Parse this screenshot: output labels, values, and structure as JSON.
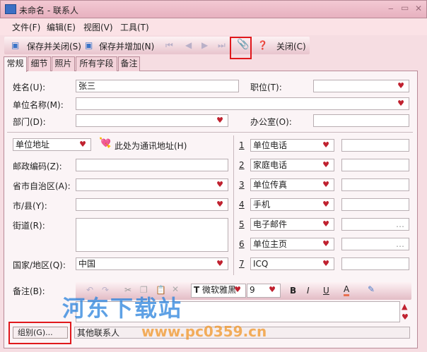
{
  "window": {
    "title": "未命名 - 联系人",
    "min": "‒",
    "max": "▭",
    "close": "✕"
  },
  "menu": [
    "文件(F)",
    "编辑(E)",
    "视图(V)",
    "工具(T)"
  ],
  "toolbar": {
    "save_close": "保存并关闭(S)",
    "save_add": "保存并增加(N)",
    "close": "关闭(C)"
  },
  "tabs": [
    "常规",
    "细节",
    "照片",
    "所有字段",
    "备注"
  ],
  "fields": {
    "name_label": "姓名(U):",
    "name_value": "张三",
    "title_label": "职位(T):",
    "title_value": "",
    "company_label": "单位名称(M):",
    "company_value": "",
    "dept_label": "部门(D):",
    "dept_value": "",
    "office_label": "办公室(O):",
    "office_value": ""
  },
  "address": {
    "type": "单位地址",
    "mailing_label": "此处为通讯地址(H)",
    "zip_label": "邮政编码(Z):",
    "province_label": "省市自治区(A):",
    "city_label": "市/县(Y):",
    "street_label": "街道(R):",
    "country_label": "国家/地区(Q):",
    "country_value": "中国"
  },
  "phones": [
    {
      "num": "1",
      "type": "单位电话",
      "value": ""
    },
    {
      "num": "2",
      "type": "家庭电话",
      "value": ""
    },
    {
      "num": "3",
      "type": "单位传真",
      "value": ""
    },
    {
      "num": "4",
      "type": "手机",
      "value": ""
    },
    {
      "num": "5",
      "type": "电子邮件",
      "value": "…"
    },
    {
      "num": "6",
      "type": "单位主页",
      "value": "…"
    },
    {
      "num": "7",
      "type": "ICQ",
      "value": ""
    }
  ],
  "notes": {
    "label": "备注(B):",
    "font": "微软雅黑",
    "size": "9",
    "bold": "B",
    "italic": "I",
    "underline": "U",
    "fontcolor": "A"
  },
  "group": {
    "button": "组别(G)...",
    "value": "其他联系人"
  },
  "watermark": {
    "name": "河东下载站",
    "url": "www.pc0359.cn"
  }
}
